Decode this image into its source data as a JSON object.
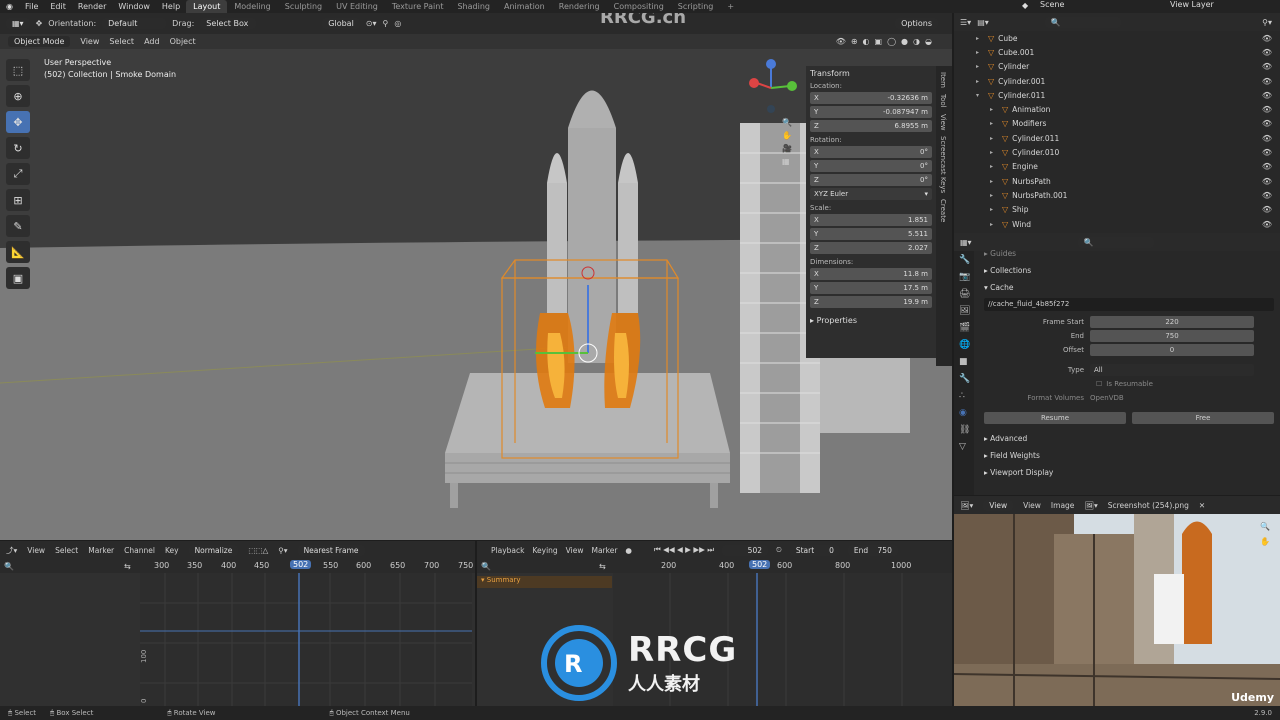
{
  "menu": [
    "File",
    "Edit",
    "Render",
    "Window",
    "Help"
  ],
  "workspaces": [
    "Layout",
    "Modeling",
    "Sculpting",
    "UV Editing",
    "Texture Paint",
    "Shading",
    "Animation",
    "Rendering",
    "Compositing",
    "Scripting"
  ],
  "top_right": {
    "scene": "Scene",
    "view_layer": "View Layer"
  },
  "viewport": {
    "orientation_label": "Orientation:",
    "orientation": "Default",
    "drag_label": "Drag:",
    "drag": "Select Box",
    "global": "Global",
    "options": "Options",
    "mode": "Object Mode",
    "menus": [
      "View",
      "Select",
      "Add",
      "Object"
    ],
    "info_line1": "User Perspective",
    "info_line2": "(502) Collection | Smoke Domain"
  },
  "transform": {
    "title": "Transform",
    "location_label": "Location:",
    "loc": {
      "x": "-0.32636 m",
      "y": "-0.087947 m",
      "z": "6.8955 m"
    },
    "rotation_label": "Rotation:",
    "rot": {
      "x": "0°",
      "y": "0°",
      "z": "0°"
    },
    "rot_mode": "XYZ Euler",
    "scale_label": "Scale:",
    "scale": {
      "x": "1.851",
      "y": "5.511",
      "z": "2.027"
    },
    "dimensions_label": "Dimensions:",
    "dim": {
      "x": "11.8 m",
      "y": "17.5 m",
      "z": "19.9 m"
    },
    "properties": "Properties"
  },
  "npanel_tabs": [
    "Item",
    "Tool",
    "View",
    "Screencast Keys",
    "Create"
  ],
  "outliner": [
    {
      "name": "Cube",
      "level": 1,
      "open": false
    },
    {
      "name": "Cube.001",
      "level": 1,
      "open": false
    },
    {
      "name": "Cylinder",
      "level": 1,
      "open": false
    },
    {
      "name": "Cylinder.001",
      "level": 1,
      "open": false
    },
    {
      "name": "Cylinder.011",
      "level": 1,
      "open": true
    },
    {
      "name": "Animation",
      "level": 2,
      "open": false
    },
    {
      "name": "Modifiers",
      "level": 2,
      "open": false
    },
    {
      "name": "Cylinder.011",
      "level": 2,
      "open": false
    },
    {
      "name": "Cylinder.010",
      "level": 2,
      "open": false
    },
    {
      "name": "Engine",
      "level": 2,
      "open": false
    },
    {
      "name": "NurbsPath",
      "level": 2,
      "open": false
    },
    {
      "name": "NurbsPath.001",
      "level": 2,
      "open": false
    },
    {
      "name": "Ship",
      "level": 2,
      "open": false
    },
    {
      "name": "Wind",
      "level": 2,
      "open": false
    }
  ],
  "properties": {
    "guides": "Guides",
    "collections": "Collections",
    "cache": "Cache",
    "cache_path": "//cache_fluid_4b85f272",
    "frame_start_label": "Frame Start",
    "frame_start": "220",
    "end_label": "End",
    "end": "750",
    "offset_label": "Offset",
    "offset": "0",
    "type_label": "Type",
    "type": "All",
    "resumable": "Is Resumable",
    "format_label": "Format Volumes",
    "format": "OpenVDB",
    "resume": "Resume",
    "free": "Free",
    "advanced": "Advanced",
    "field_weights": "Field Weights",
    "viewport_display": "Viewport Display"
  },
  "image_editor": {
    "menus": [
      "View",
      "View",
      "Image"
    ],
    "image_name": "Screenshot (254).png",
    "brand": "Udemy"
  },
  "dopesheet": {
    "menus": [
      "View",
      "Select",
      "Marker",
      "Channel",
      "Key"
    ],
    "normalize": "Normalize",
    "nearest": "Nearest Frame",
    "ruler": [
      "300",
      "350",
      "400",
      "450",
      "502",
      "550",
      "600",
      "650",
      "700",
      "750"
    ],
    "y_labels": [
      "100",
      "0"
    ]
  },
  "timeline": {
    "menus": [
      "Playback",
      "Keying",
      "View",
      "Marker"
    ],
    "current_frame": "502",
    "start_label": "Start",
    "start": "0",
    "end_label": "End",
    "end": "750",
    "summary": "Summary",
    "ruler": [
      "200",
      "400",
      "502",
      "600",
      "800",
      "1000"
    ]
  },
  "status": [
    "Select",
    "Box Select",
    "Rotate View",
    "Object Context Menu"
  ],
  "version": "2.9.0",
  "watermark": {
    "top": "RRCG.cn",
    "logo_top": "RRCG",
    "logo_bottom": "人人素材"
  },
  "colors": {
    "accent": "#4772b3",
    "selection": "#e08a2a",
    "fire": "#e07a10"
  }
}
